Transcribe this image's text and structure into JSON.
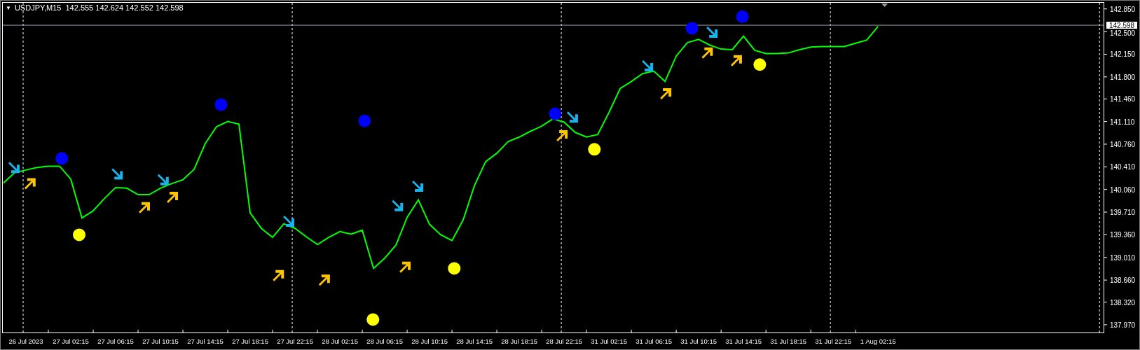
{
  "header": {
    "arrow": "▼",
    "text": "USDJPY,M15  142.555 142.624 142.552 142.598"
  },
  "chart_data": {
    "type": "line",
    "categories": [
      null,
      null,
      "26 Jul 2023",
      null,
      null,
      null,
      "27 Jul 02:15",
      null,
      null,
      null,
      "27 Jul 06:15",
      null,
      null,
      null,
      "27 Jul 10:15",
      null,
      null,
      null,
      "27 Jul 14:15",
      null,
      null,
      null,
      "27 Jul 18:15",
      null,
      null,
      null,
      "27 Jul 22:15",
      null,
      null,
      null,
      "28 Jul 02:15",
      null,
      null,
      null,
      "28 Jul 06:15",
      null,
      null,
      null,
      "28 Jul 10:15",
      null,
      null,
      null,
      "28 Jul 14:15",
      null,
      null,
      null,
      "28 Jul 18:15",
      null,
      null,
      null,
      "28 Jul 22:15",
      null,
      null,
      null,
      "31 Jul 02:15",
      null,
      null,
      null,
      "31 Jul 06:15",
      null,
      null,
      null,
      "31 Jul 10:15",
      null,
      null,
      null,
      "31 Jul 14:15",
      null,
      null,
      null,
      "31 Jul 18:15",
      null,
      null,
      null,
      "31 Jul 22:15",
      null,
      null,
      null,
      "1 Aug 02:15",
      null,
      null,
      null,
      null,
      null,
      null,
      null,
      null,
      null,
      null,
      null,
      null,
      null,
      null,
      null,
      null,
      null,
      null,
      null
    ],
    "series": [
      {
        "color": "#00ff00",
        "values": [
          140.16,
          140.32,
          140.36,
          140.4,
          140.42,
          140.42,
          140.22,
          139.62,
          139.73,
          139.92,
          140.09,
          140.08,
          139.98,
          139.98,
          140.08,
          140.15,
          140.21,
          140.37,
          140.77,
          141.03,
          141.11,
          141.07,
          139.7,
          139.46,
          139.32,
          139.53,
          139.46,
          139.33,
          139.21,
          139.32,
          139.41,
          139.37,
          139.43,
          138.84,
          139.0,
          139.2,
          139.63,
          139.9,
          139.52,
          139.36,
          139.27,
          139.59,
          140.12,
          140.49,
          140.62,
          140.8,
          140.87,
          140.96,
          141.04,
          141.15,
          141.1,
          140.94,
          140.87,
          140.91,
          141.25,
          141.62,
          141.73,
          141.85,
          141.89,
          141.73,
          142.12,
          142.33,
          142.38,
          142.29,
          142.23,
          142.22,
          142.43,
          142.21,
          142.16,
          142.16,
          142.17,
          142.22,
          142.26,
          142.27,
          142.27,
          142.27,
          142.32,
          142.37,
          142.58,
          null,
          null,
          null,
          null,
          null,
          null,
          null,
          null,
          null,
          null,
          null,
          null,
          null,
          null,
          null,
          null,
          null,
          null,
          null
        ]
      }
    ],
    "ylim": [
      137.85,
      142.95
    ],
    "yticks": [
      {
        "value": 142.85,
        "label": "142.850"
      },
      {
        "value": 142.5,
        "label": "142.500"
      },
      {
        "value": 142.15,
        "label": "142.150"
      },
      {
        "value": 141.8,
        "label": "141.800"
      },
      {
        "value": 141.46,
        "label": "141.460"
      },
      {
        "value": 141.11,
        "label": "141.110"
      },
      {
        "value": 140.76,
        "label": "140.760"
      },
      {
        "value": 140.41,
        "label": "140.410"
      },
      {
        "value": 140.06,
        "label": "140.060"
      },
      {
        "value": 139.71,
        "label": "139.710"
      },
      {
        "value": 139.36,
        "label": "139.360"
      },
      {
        "value": 139.01,
        "label": "139.010"
      },
      {
        "value": 138.66,
        "label": "138.660"
      },
      {
        "value": 138.32,
        "label": "138.320"
      },
      {
        "value": 137.97,
        "label": "137.970"
      }
    ],
    "ref_lines": [
      {
        "axis": "y",
        "value": 142.598,
        "label": "142.598"
      }
    ]
  }
}
